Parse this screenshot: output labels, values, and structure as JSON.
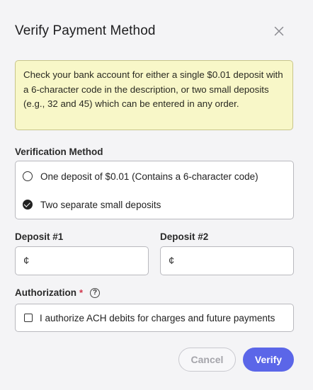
{
  "dialog": {
    "title": "Verify Payment Method",
    "notice": "Check your bank account for either a single $0.01 deposit with a 6-character code in the description, or two small deposits (e.g., 32 and 45) which can be entered in any order."
  },
  "verification": {
    "label": "Verification Method",
    "options": [
      {
        "label": "One deposit of $0.01 (Contains a 6-character code)",
        "selected": false
      },
      {
        "label": "Two separate small deposits",
        "selected": true
      }
    ]
  },
  "deposits": {
    "deposit1_label": "Deposit #1",
    "deposit2_label": "Deposit #2",
    "currency_symbol": "¢",
    "deposit1_value": "",
    "deposit2_value": ""
  },
  "authorization": {
    "label": "Authorization",
    "required_marker": "*",
    "help_glyph": "?",
    "checkbox_label": "I authorize ACH debits for charges and future payments",
    "checked": false
  },
  "actions": {
    "cancel_label": "Cancel",
    "verify_label": "Verify"
  },
  "colors": {
    "primary": "#5b66e8",
    "notice_bg": "#f8f7c8",
    "required": "#d0344a"
  }
}
